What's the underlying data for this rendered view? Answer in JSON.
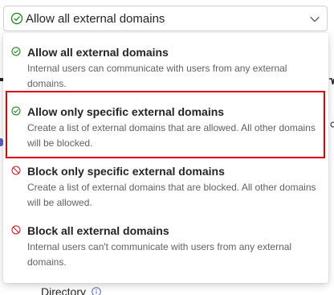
{
  "select": {
    "value": "Allow all external domains",
    "icon": "checkmark-circle-icon",
    "chevron": "chevron-down-icon"
  },
  "options": [
    {
      "title": "Allow all external domains",
      "description": "Internal users can communicate with users from any external domains.",
      "icon": "checkmark-circle-icon"
    },
    {
      "title": "Allow only specific external domains",
      "description": "Create a list of external domains that are allowed. All other domains will be blocked.",
      "icon": "checkmark-circle-icon"
    },
    {
      "title": "Block only specific external domains",
      "description": "Create a list of external domains that are blocked. All other domains will be allowed.",
      "icon": "blocked-icon"
    },
    {
      "title": "Block all external domains",
      "description": "Internal users can't communicate with users from any external domains.",
      "icon": "blocked-icon"
    }
  ],
  "background": {
    "directory_label": "Directory"
  },
  "colors": {
    "check_green": "#107c10",
    "block_red": "#c50f1f",
    "highlight_border": "#e0000a"
  }
}
